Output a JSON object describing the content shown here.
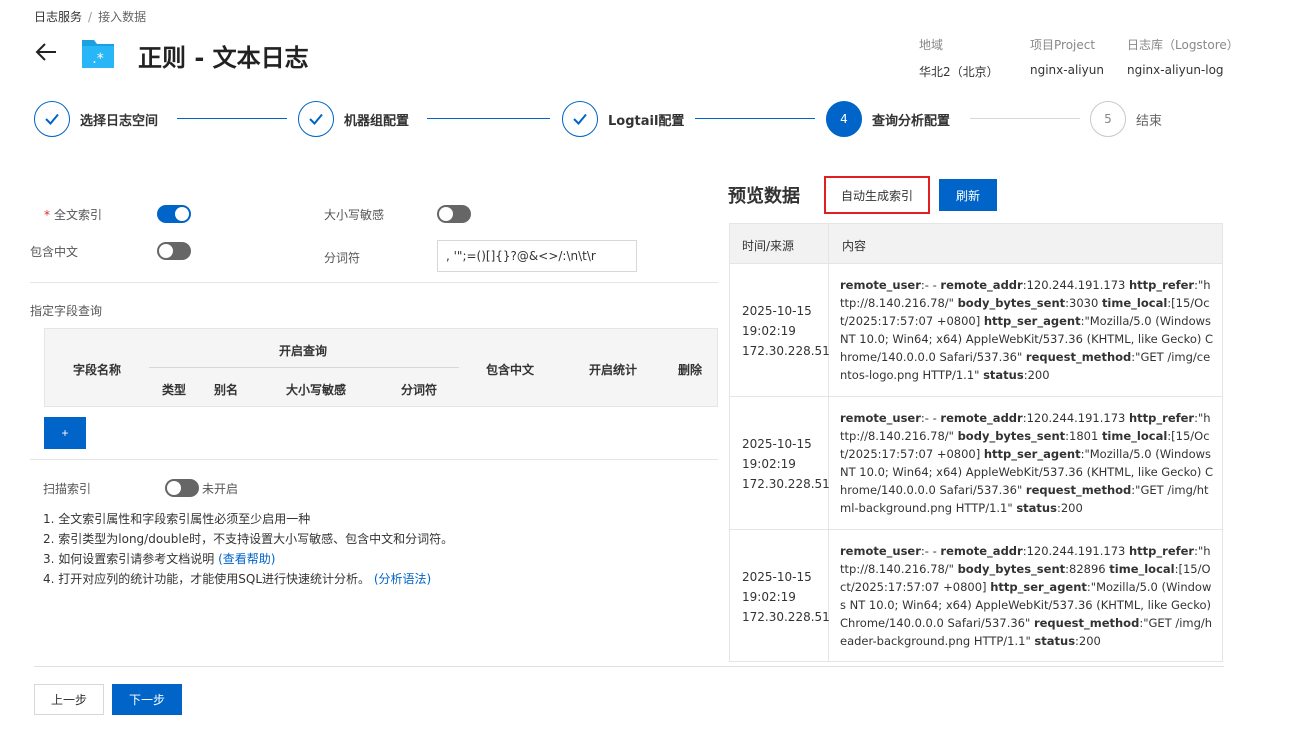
{
  "breadcrumb": {
    "root": "日志服务",
    "separator": "/",
    "current": "接入数据"
  },
  "header": {
    "title": "正则 - 文本日志",
    "meta": [
      {
        "label": "地域",
        "value": "华北2（北京）"
      },
      {
        "label": "项目Project",
        "value": "nginx-aliyun"
      },
      {
        "label": "日志库（Logstore）",
        "value": "nginx-aliyun-log"
      }
    ]
  },
  "steps": [
    {
      "label": "选择日志空间",
      "state": "done"
    },
    {
      "label": "机器组配置",
      "state": "done"
    },
    {
      "label": "Logtail配置",
      "state": "done"
    },
    {
      "number": "4",
      "label": "查询分析配置",
      "state": "active"
    },
    {
      "number": "5",
      "label": "结束",
      "state": "pending"
    }
  ],
  "form": {
    "fulltext_index_label": "全文索引",
    "fulltext_index_required_mark": "*",
    "fulltext_index_on": true,
    "case_sensitive_label": "大小写敏感",
    "case_sensitive_on": false,
    "include_chinese_label": "包含中文",
    "include_chinese_on": false,
    "delimiter_label": "分词符",
    "delimiter_value": ", '\";=()[]{}?@&<>/:\\n\\t\\r",
    "field_query_title": "指定字段查询",
    "table_headers": {
      "field_name": "字段名称",
      "enable_query": "开启查询",
      "type": "类型",
      "alias": "别名",
      "case_sensitive": "大小写敏感",
      "delimiter": "分词符",
      "include_chinese": "包含中文",
      "enable_stats": "开启统计",
      "delete": "删除"
    },
    "add_button": "+",
    "scan_index_label": "扫描索引",
    "scan_index_on": false,
    "scan_index_status": "未开启",
    "notes": [
      {
        "text": "1. 全文索引属性和字段索引属性必须至少启用一种",
        "link": ""
      },
      {
        "text": "2. 索引类型为long/double时，不支持设置大小写敏感、包含中文和分词符。",
        "link": ""
      },
      {
        "text": "3. 如何设置索引请参考文档说明",
        "link": "(查看帮助)"
      },
      {
        "text": "4. 打开对应列的统计功能，才能使用SQL进行快速统计分析。",
        "link": "(分析语法)"
      }
    ]
  },
  "preview": {
    "title": "预览数据",
    "auto_index_button": "自动生成索引",
    "refresh_button": "刷新",
    "col_time": "时间/来源",
    "col_content": "内容",
    "rows": [
      {
        "date": "2025-10-15",
        "time": "19:02:19",
        "source": "172.30.228.51",
        "fields": [
          {
            "k": "remote_user",
            "v": "- - "
          },
          {
            "k": "remote_addr",
            "v": "120.244.191.173 "
          },
          {
            "k": "http_refer",
            "v": "\"http://8.140.216.78/\" "
          },
          {
            "k": "body_bytes_sent",
            "v": "3030 "
          },
          {
            "k": "time_local",
            "v": "[15/Oct/2025:17:57:07 +0800] "
          },
          {
            "k": "http_ser_agent",
            "v": "\"Mozilla/5.0 (Windows NT 10.0; Win64; x64) AppleWebKit/537.36 (KHTML, like Gecko) Chrome/140.0.0.0 Safari/537.36\" "
          },
          {
            "k": "request_method",
            "v": "\"GET /img/centos-logo.png HTTP/1.1\" "
          },
          {
            "k": "status",
            "v": "200"
          }
        ]
      },
      {
        "date": "2025-10-15",
        "time": "19:02:19",
        "source": "172.30.228.51",
        "fields": [
          {
            "k": "remote_user",
            "v": "- - "
          },
          {
            "k": "remote_addr",
            "v": "120.244.191.173 "
          },
          {
            "k": "http_refer",
            "v": "\"http://8.140.216.78/\" "
          },
          {
            "k": "body_bytes_sent",
            "v": "1801 "
          },
          {
            "k": "time_local",
            "v": "[15/Oct/2025:17:57:07 +0800] "
          },
          {
            "k": "http_ser_agent",
            "v": "\"Mozilla/5.0 (Windows NT 10.0; Win64; x64) AppleWebKit/537.36 (KHTML, like Gecko) Chrome/140.0.0.0 Safari/537.36\" "
          },
          {
            "k": "request_method",
            "v": "\"GET /img/html-background.png HTTP/1.1\" "
          },
          {
            "k": "status",
            "v": "200"
          }
        ]
      },
      {
        "date": "2025-10-15",
        "time": "19:02:19",
        "source": "172.30.228.51",
        "fields": [
          {
            "k": "remote_user",
            "v": "- - "
          },
          {
            "k": "remote_addr",
            "v": "120.244.191.173 "
          },
          {
            "k": "http_refer",
            "v": "\"http://8.140.216.78/\" "
          },
          {
            "k": "body_bytes_sent",
            "v": "82896 "
          },
          {
            "k": "time_local",
            "v": "[15/Oct/2025:17:57:07 +0800] "
          },
          {
            "k": "http_ser_agent",
            "v": "\"Mozilla/5.0 (Windows NT 10.0; Win64; x64) AppleWebKit/537.36 (KHTML, like Gecko) Chrome/140.0.0.0 Safari/537.36\" "
          },
          {
            "k": "request_method",
            "v": "\"GET /img/header-background.png HTTP/1.1\" "
          },
          {
            "k": "status",
            "v": "200"
          }
        ]
      }
    ]
  },
  "footer": {
    "prev_button": "上一步",
    "next_button": "下一步"
  },
  "colors": {
    "primary": "#0064c8",
    "highlight_border": "#e02020",
    "toggle_off": "#666666"
  },
  "icons": {
    "back": "arrow-left-icon",
    "log_type": "folder-star-icon",
    "done": "check-icon"
  }
}
